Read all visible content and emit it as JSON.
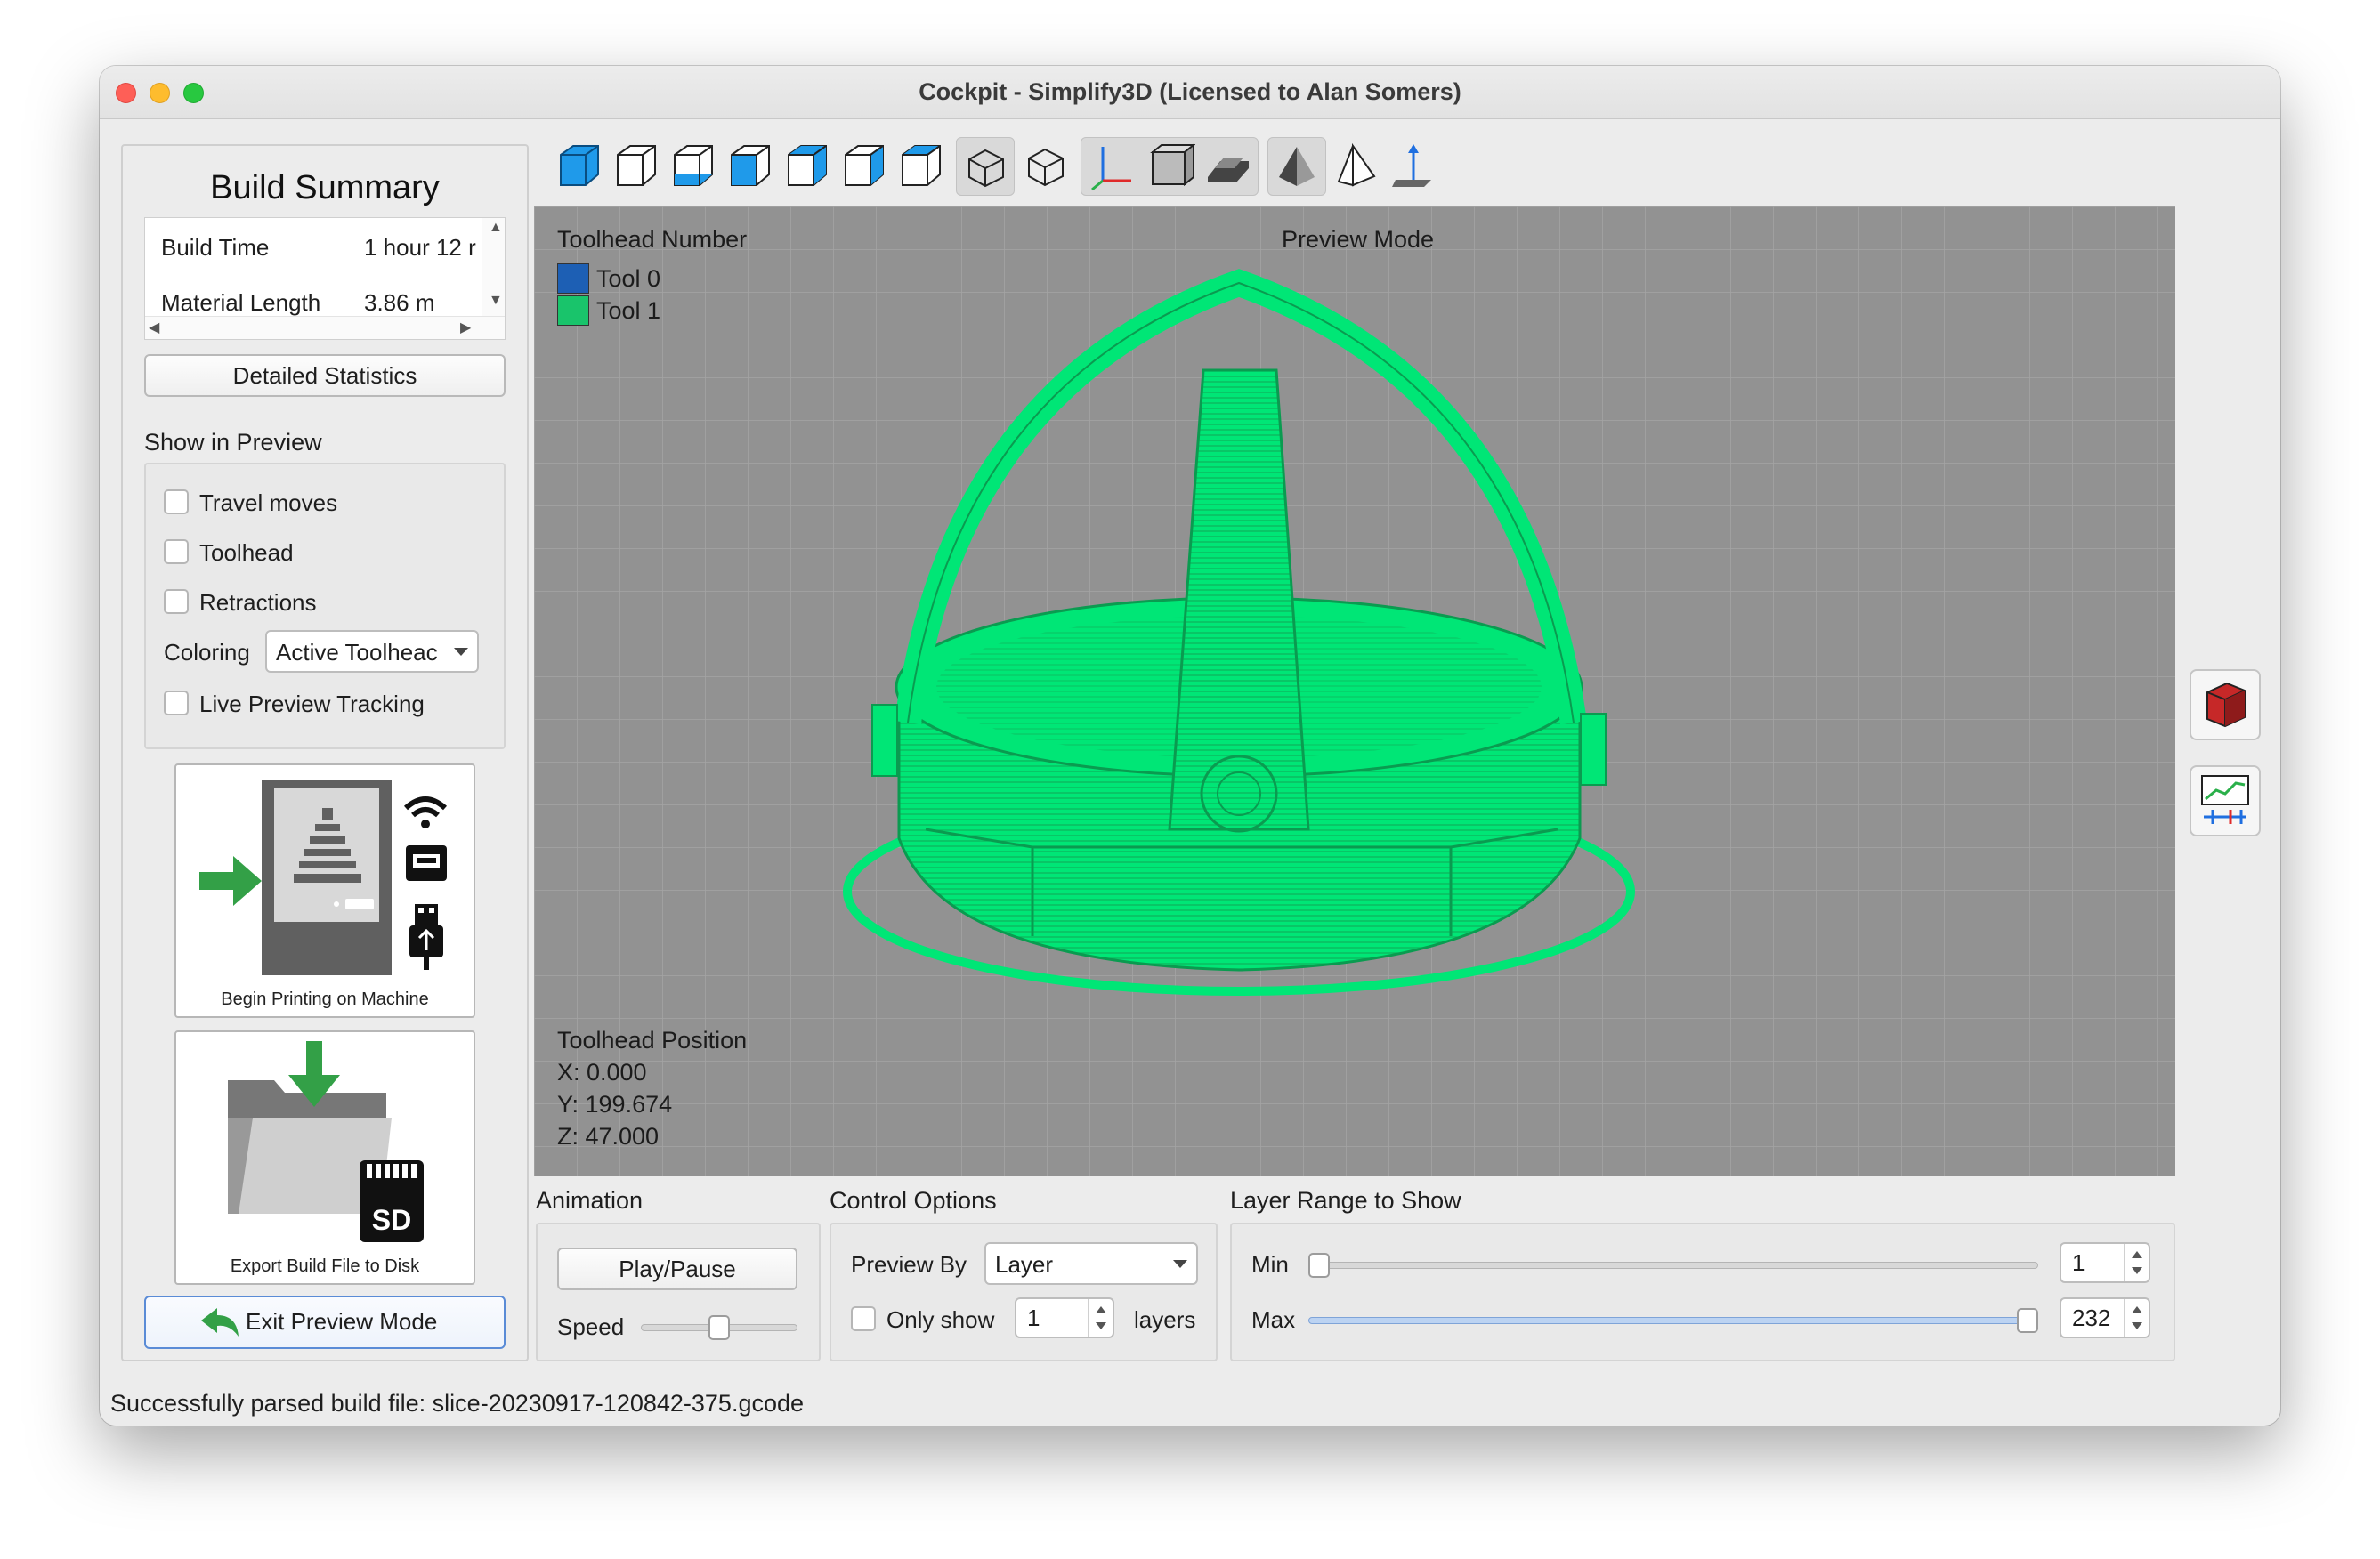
{
  "window": {
    "title": "Cockpit - Simplify3D (Licensed to Alan Somers)"
  },
  "build_summary": {
    "title": "Build Summary",
    "rows": [
      {
        "label": "Build Time",
        "value": "1 hour 12 r"
      },
      {
        "label": "Material Length",
        "value": "3.86 m"
      }
    ],
    "detailed_statistics_label": "Detailed Statistics"
  },
  "show_in_preview": {
    "label": "Show in Preview",
    "travel_moves": {
      "label": "Travel moves",
      "checked": false
    },
    "toolhead": {
      "label": "Toolhead",
      "checked": false
    },
    "retractions": {
      "label": "Retractions",
      "checked": false
    },
    "coloring_label": "Coloring",
    "coloring_value": "Active Toolheac",
    "live_preview": {
      "label": "Live Preview Tracking",
      "checked": false
    }
  },
  "actions": {
    "begin_printing_label": "Begin Printing on Machine",
    "export_label": "Export Build File to Disk",
    "sd_text": "SD",
    "exit_preview_label": "Exit Preview Mode"
  },
  "toolbar": {
    "icons": [
      "view-iso-solid-icon",
      "view-front-icon",
      "view-back-icon",
      "view-left-icon",
      "view-right-icon",
      "view-top-icon",
      "view-bottom-icon",
      "perspective-icon",
      "wireframe-cube-icon",
      "axes-icon",
      "build-volume-icon",
      "platform-icon",
      "cross-section-icon",
      "mirror-icon",
      "move-icon"
    ]
  },
  "viewport": {
    "toolhead_number_label": "Toolhead Number",
    "preview_mode_label": "Preview Mode",
    "legend": [
      {
        "name": "Tool 0",
        "color": "#1d5fb4"
      },
      {
        "name": "Tool 1",
        "color": "#19c46b"
      }
    ],
    "toolhead_position_label": "Toolhead Position",
    "x": "X: 0.000",
    "y": "Y: 199.674",
    "z": "Z: 47.000",
    "model_color": "#00e676",
    "background_color": "#929292"
  },
  "animation": {
    "title": "Animation",
    "play_pause_label": "Play/Pause",
    "speed_label": "Speed",
    "speed_level": 0.5
  },
  "control_options": {
    "title": "Control Options",
    "preview_by_label": "Preview By",
    "preview_by_value": "Layer",
    "only_show_label": "Only show",
    "only_show_checked": false,
    "only_show_value": "1",
    "layers_label": "layers"
  },
  "layer_range": {
    "title": "Layer Range to Show",
    "min_label": "Min",
    "min_value": "1",
    "max_label": "Max",
    "max_value": "232"
  },
  "status": {
    "text": "Successfully parsed build file: slice-20230917-120842-375.gcode"
  }
}
